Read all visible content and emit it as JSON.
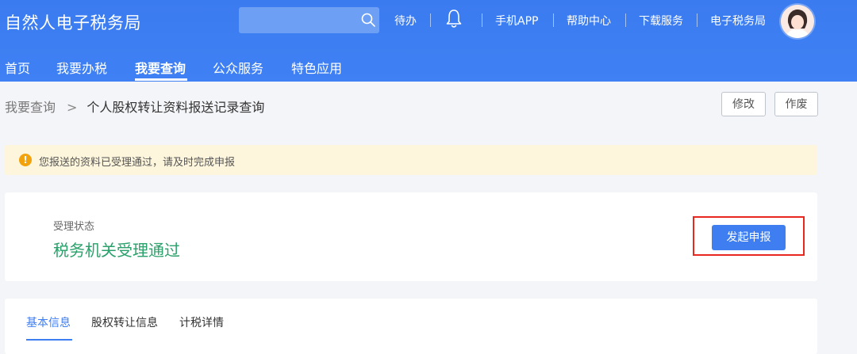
{
  "header": {
    "title": "自然人电子税务局",
    "search": {
      "placeholder": "",
      "icon": "search-icon"
    },
    "links": [
      "待办",
      "手机APP",
      "帮助中心",
      "下载服务",
      "电子税务局"
    ],
    "bell_icon": "bell-icon",
    "brand_color": "#3d7ef2"
  },
  "nav": {
    "items": [
      "首页",
      "我要办税",
      "我要查询",
      "公众服务",
      "特色应用"
    ],
    "active": "我要查询"
  },
  "breadcrumb": {
    "parent": "我要查询",
    "separator": ">",
    "current": "个人股权转让资料报送记录查询"
  },
  "actions": {
    "modify": "修改",
    "void": "作废"
  },
  "notice": {
    "icon": "!",
    "text": "您报送的资料已受理通过，请及时完成申报"
  },
  "status": {
    "label": "受理状态",
    "value": "税务机关受理通过",
    "value_color": "#2aa06a",
    "button": "发起申报"
  },
  "tabs": {
    "items": [
      "基本信息",
      "股权转让信息",
      "计税详情"
    ],
    "active": "基本信息"
  }
}
